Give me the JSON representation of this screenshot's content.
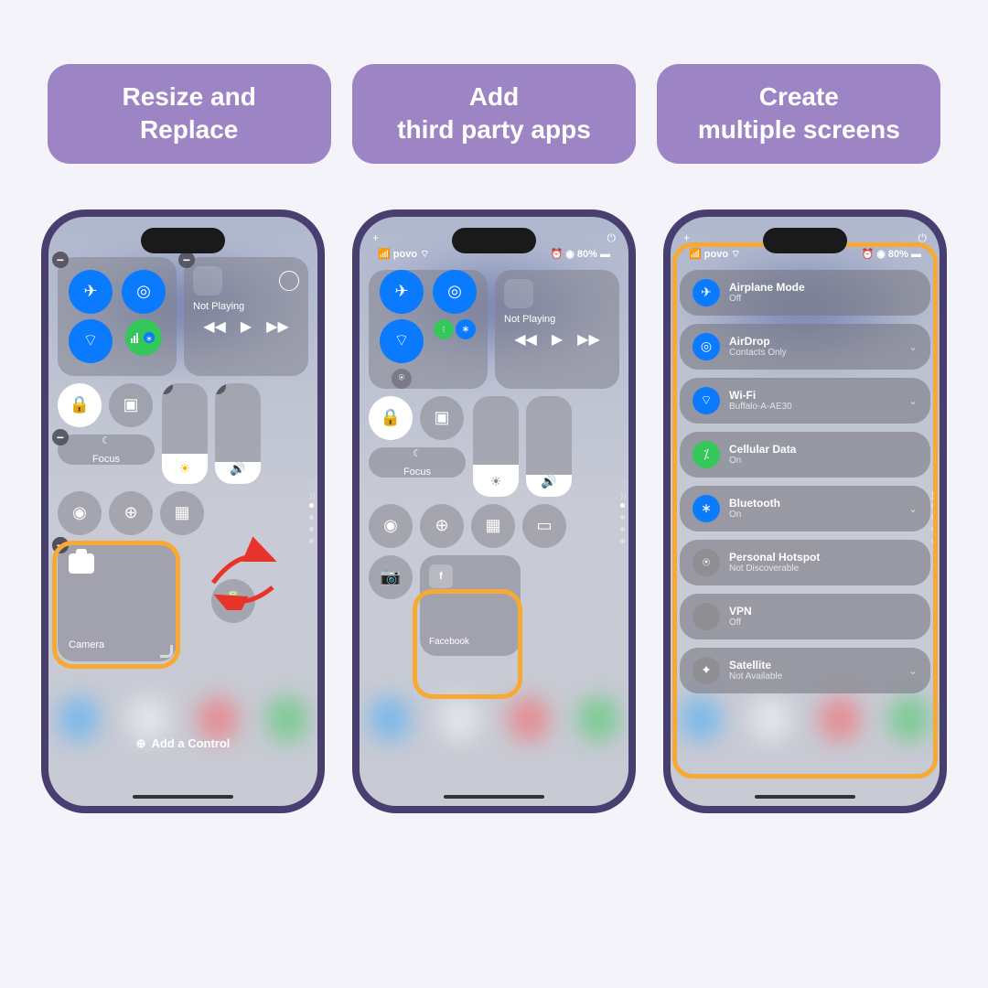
{
  "labels": {
    "l1": "Resize and\nReplace",
    "l2": "Add\nthird party apps",
    "l3": "Create\nmultiple screens"
  },
  "status": {
    "carrier": "povo",
    "battery": "80%"
  },
  "screen1": {
    "not_playing": "Not Playing",
    "focus": "Focus",
    "camera": "Camera",
    "add_control": "Add a Control"
  },
  "screen2": {
    "not_playing": "Not Playing",
    "focus": "Focus",
    "facebook": "Facebook"
  },
  "screen3": {
    "items": [
      {
        "title": "Airplane Mode",
        "sub": "Off",
        "color": "#0a7aff",
        "icon": "✈"
      },
      {
        "title": "AirDrop",
        "sub": "Contacts Only",
        "color": "#0a7aff",
        "icon": "◎",
        "expand": true
      },
      {
        "title": "Wi-Fi",
        "sub": "Buffalo-A-AE30",
        "color": "#0a7aff",
        "icon": "⌔",
        "expand": true
      },
      {
        "title": "Cellular Data",
        "sub": "On",
        "color": "#34c759",
        "icon": "⁒"
      },
      {
        "title": "Bluetooth",
        "sub": "On",
        "color": "#0a7aff",
        "icon": "∗",
        "expand": true
      },
      {
        "title": "Personal Hotspot",
        "sub": "Not Discoverable",
        "color": "#8e8e93",
        "icon": "⍟"
      },
      {
        "title": "VPN",
        "sub": "Off",
        "color": "#8e8e93",
        "icon": ""
      },
      {
        "title": "Satellite",
        "sub": "Not Available",
        "color": "#8e8e93",
        "icon": "✦",
        "expand": true
      }
    ]
  }
}
